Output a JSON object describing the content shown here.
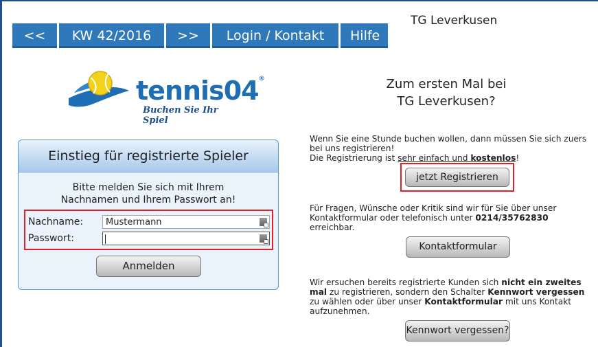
{
  "header": {
    "club_name": "TG Leverkusen",
    "nav": [
      "<<",
      "KW 42/2016",
      ">>",
      "Login / Kontakt",
      "Hilfe"
    ]
  },
  "logo": {
    "wordmark": "tennis",
    "wordmark_num": "04",
    "registered": "®",
    "slogan": "Buchen Sie Ihr Spiel"
  },
  "login": {
    "title": "Einstieg für registrierte Spieler",
    "message_line1": "Bitte melden Sie sich mit Ihrem",
    "message_line2": "Nachnamen und Ihrem Passwort an!",
    "lastname_label": "Nachname:",
    "lastname_value": "Mustermann",
    "password_label": "Passwort:",
    "password_value": "",
    "submit_label": "Anmelden",
    "field_icon": "key-icon"
  },
  "register": {
    "welcome_line1": "Zum ersten Mal bei",
    "welcome_line2": "TG Leverkusen?",
    "text_line1": "Wenn Sie eine Stunde buchen wollen, dann müssen Sie sich zuers",
    "text_line2": "bei uns registrieren!",
    "text_line3_a": "Die Registrierung ist ",
    "text_line3_b": "sehr einfach und ",
    "text_line3_c": "kostenlos",
    "text_line3_d": "!",
    "button_label": "jetzt Registrieren"
  },
  "contact": {
    "text_a": "Für Fragen, Wünsche oder Kritik sind wir für Sie über unser",
    "text_b": "Kontaktformular oder telefonisch unter ",
    "phone": "0214/35762830",
    "text_c": "erreichbar.",
    "button_label": "Kontaktformular"
  },
  "forgot": {
    "t1": "Wir ersuchen bereits registrierte Kunden sich ",
    "t1b": "nicht ein zweites",
    "t2b": "mal",
    "t2": " zu registrieren, sondern den Schalter ",
    "t2c": "Kennwort vergessen",
    "t3": "zu wählen oder über unser ",
    "t3b": "Kontaktformular",
    "t3c": " mit uns Kontakt",
    "t4": "aufzunehmen.",
    "button_label": "Kennwort vergessen?"
  },
  "colors": {
    "nav_blue": "#2f78b9",
    "highlight_red": "#e31e24",
    "panel_bg": "#eaf2fb"
  }
}
